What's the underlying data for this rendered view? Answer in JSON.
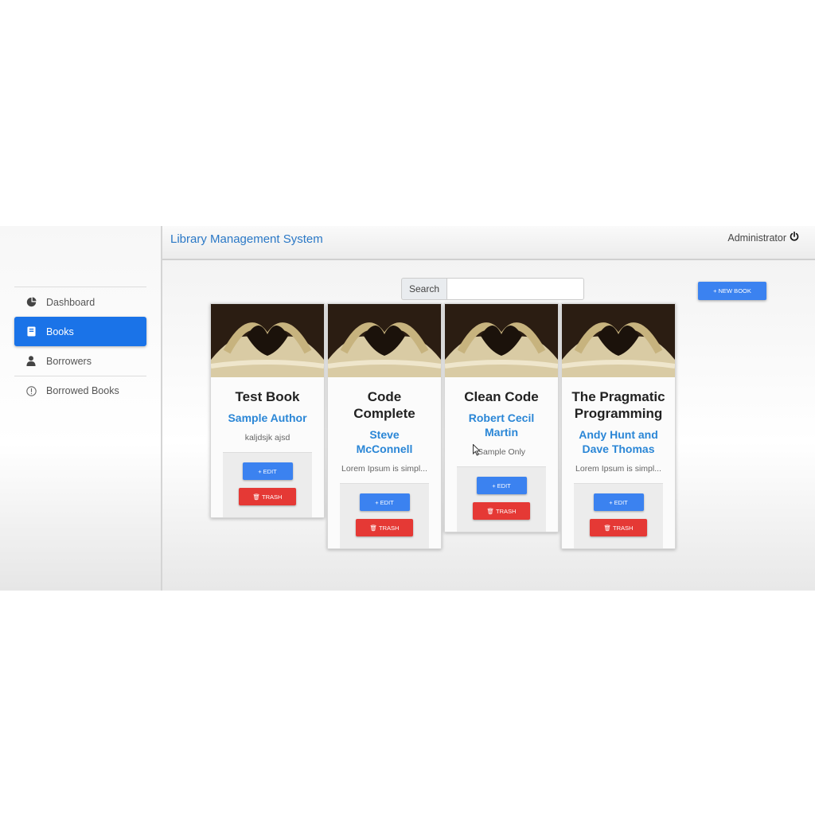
{
  "header": {
    "title": "Library Management System",
    "user": "Administrator"
  },
  "sidebar": {
    "items": [
      {
        "label": "Dashboard",
        "icon": "pie-chart-icon"
      },
      {
        "label": "Books",
        "icon": "book-icon",
        "active": true
      },
      {
        "label": "Borrowers",
        "icon": "user-icon"
      },
      {
        "label": "Borrowed Books",
        "icon": "info-circle-icon"
      }
    ]
  },
  "search": {
    "label": "Search",
    "value": ""
  },
  "toolbar": {
    "new_book_label": "+ NEW BOOK"
  },
  "books": [
    {
      "title": "Test Book",
      "author": "Sample Author",
      "description": "kaljdsjk ajsd",
      "edit_label": "+ EDIT",
      "trash_label": "🗑 TRASH"
    },
    {
      "title": "Code Complete",
      "author": "Steve McConnell",
      "description": "Lorem Ipsum is simpl...",
      "edit_label": "+ EDIT",
      "trash_label": "🗑 TRASH"
    },
    {
      "title": "Clean Code",
      "author": "Robert Cecil Martin",
      "description": "Sample Only",
      "edit_label": "+ EDIT",
      "trash_label": "🗑 TRASH"
    },
    {
      "title": "The Pragmatic Programming",
      "author": "Andy Hunt and Dave Thomas",
      "description": "Lorem Ipsum is simpl...",
      "edit_label": "+ EDIT",
      "trash_label": "🗑 TRASH"
    }
  ],
  "colors": {
    "primary": "#1a73e8",
    "danger": "#e53935",
    "link": "#2a86d6"
  }
}
